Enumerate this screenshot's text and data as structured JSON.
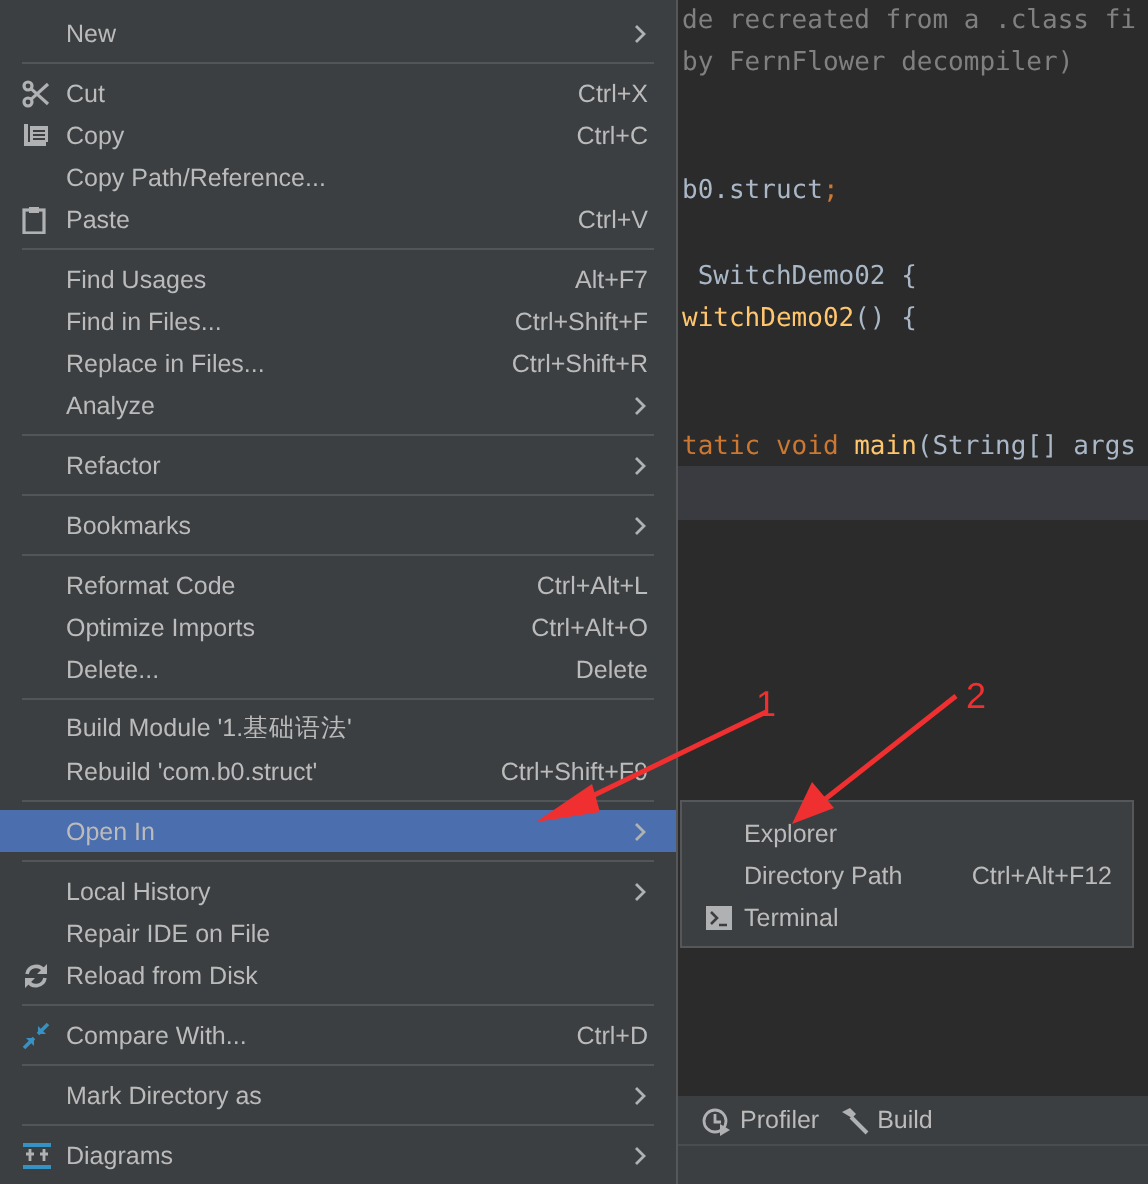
{
  "context_menu": {
    "groups": [
      [
        {
          "label": "New",
          "submenu": true,
          "selected": false
        }
      ],
      [
        {
          "label": "Cut",
          "shortcut": "Ctrl+X",
          "submenu": false,
          "selected": false
        },
        {
          "label": "Copy",
          "shortcut": "Ctrl+C",
          "submenu": false,
          "selected": false
        },
        {
          "label": "Copy Path/Reference...",
          "submenu": false,
          "selected": false
        },
        {
          "label": "Paste",
          "shortcut": "Ctrl+V",
          "submenu": false,
          "selected": false
        }
      ],
      [
        {
          "label": "Find Usages",
          "shortcut": "Alt+F7",
          "submenu": false,
          "selected": false
        },
        {
          "label": "Find in Files...",
          "shortcut": "Ctrl+Shift+F",
          "submenu": false,
          "selected": false
        },
        {
          "label": "Replace in Files...",
          "shortcut": "Ctrl+Shift+R",
          "submenu": false,
          "selected": false
        },
        {
          "label": "Analyze",
          "submenu": true,
          "selected": false
        }
      ],
      [
        {
          "label": "Refactor",
          "submenu": true,
          "selected": false
        }
      ],
      [
        {
          "label": "Bookmarks",
          "submenu": true,
          "selected": false
        }
      ],
      [
        {
          "label": "Reformat Code",
          "shortcut": "Ctrl+Alt+L",
          "submenu": false,
          "selected": false
        },
        {
          "label": "Optimize Imports",
          "shortcut": "Ctrl+Alt+O",
          "submenu": false,
          "selected": false
        },
        {
          "label": "Delete...",
          "shortcut": "Delete",
          "submenu": false,
          "selected": false
        }
      ],
      [
        {
          "label": "Build Module '1.基础语法'",
          "submenu": false,
          "selected": false
        },
        {
          "label": "Rebuild 'com.b0.struct'",
          "shortcut": "Ctrl+Shift+F9",
          "submenu": false,
          "selected": false
        }
      ],
      [
        {
          "label": "Open In",
          "submenu": true,
          "selected": true
        }
      ],
      [
        {
          "label": "Local History",
          "submenu": true,
          "selected": false
        },
        {
          "label": "Repair IDE on File",
          "submenu": false,
          "selected": false
        },
        {
          "label": "Reload from Disk",
          "submenu": false,
          "selected": false
        }
      ],
      [
        {
          "label": "Compare With...",
          "shortcut": "Ctrl+D",
          "submenu": false,
          "selected": false
        }
      ],
      [
        {
          "label": "Mark Directory as",
          "submenu": true,
          "selected": false
        }
      ],
      [
        {
          "label": "Diagrams",
          "submenu": true,
          "selected": false
        }
      ]
    ]
  },
  "submenu": {
    "items": [
      {
        "label": "Explorer"
      },
      {
        "label": "Directory Path",
        "shortcut": "Ctrl+Alt+F12"
      },
      {
        "label": "Terminal"
      }
    ]
  },
  "code_lines": [
    {
      "kind": "code",
      "segments": [
        {
          "text": "de recreated from a .class fi",
          "kind": "comment"
        }
      ]
    },
    {
      "kind": "code",
      "segments": [
        {
          "text": "by FernFlower decompiler)",
          "kind": "comment"
        }
      ]
    },
    {
      "kind": "blank"
    },
    {
      "kind": "blank"
    },
    {
      "kind": "code",
      "segments": [
        {
          "text": "b0.struct",
          "kind": "plain"
        },
        {
          "text": ";",
          "kind": "keyword"
        }
      ]
    },
    {
      "kind": "blank"
    },
    {
      "kind": "code",
      "segments": [
        {
          "text": " SwitchDemo02 {",
          "kind": "plain"
        }
      ]
    },
    {
      "kind": "code",
      "segments": [
        {
          "text": "witchDemo02",
          "kind": "method"
        },
        {
          "text": "() {",
          "kind": "plain"
        }
      ]
    },
    {
      "kind": "blank"
    },
    {
      "kind": "blank"
    },
    {
      "kind": "code",
      "segments": [
        {
          "text": "tatic void ",
          "kind": "keyword"
        },
        {
          "text": "main",
          "kind": "method"
        },
        {
          "text": "(String[] args",
          "kind": "plain"
        }
      ]
    }
  ],
  "tool_windows": [
    {
      "label": "Profiler"
    },
    {
      "label": "Build"
    }
  ],
  "annotations": [
    {
      "label": "1"
    },
    {
      "label": "2"
    }
  ]
}
